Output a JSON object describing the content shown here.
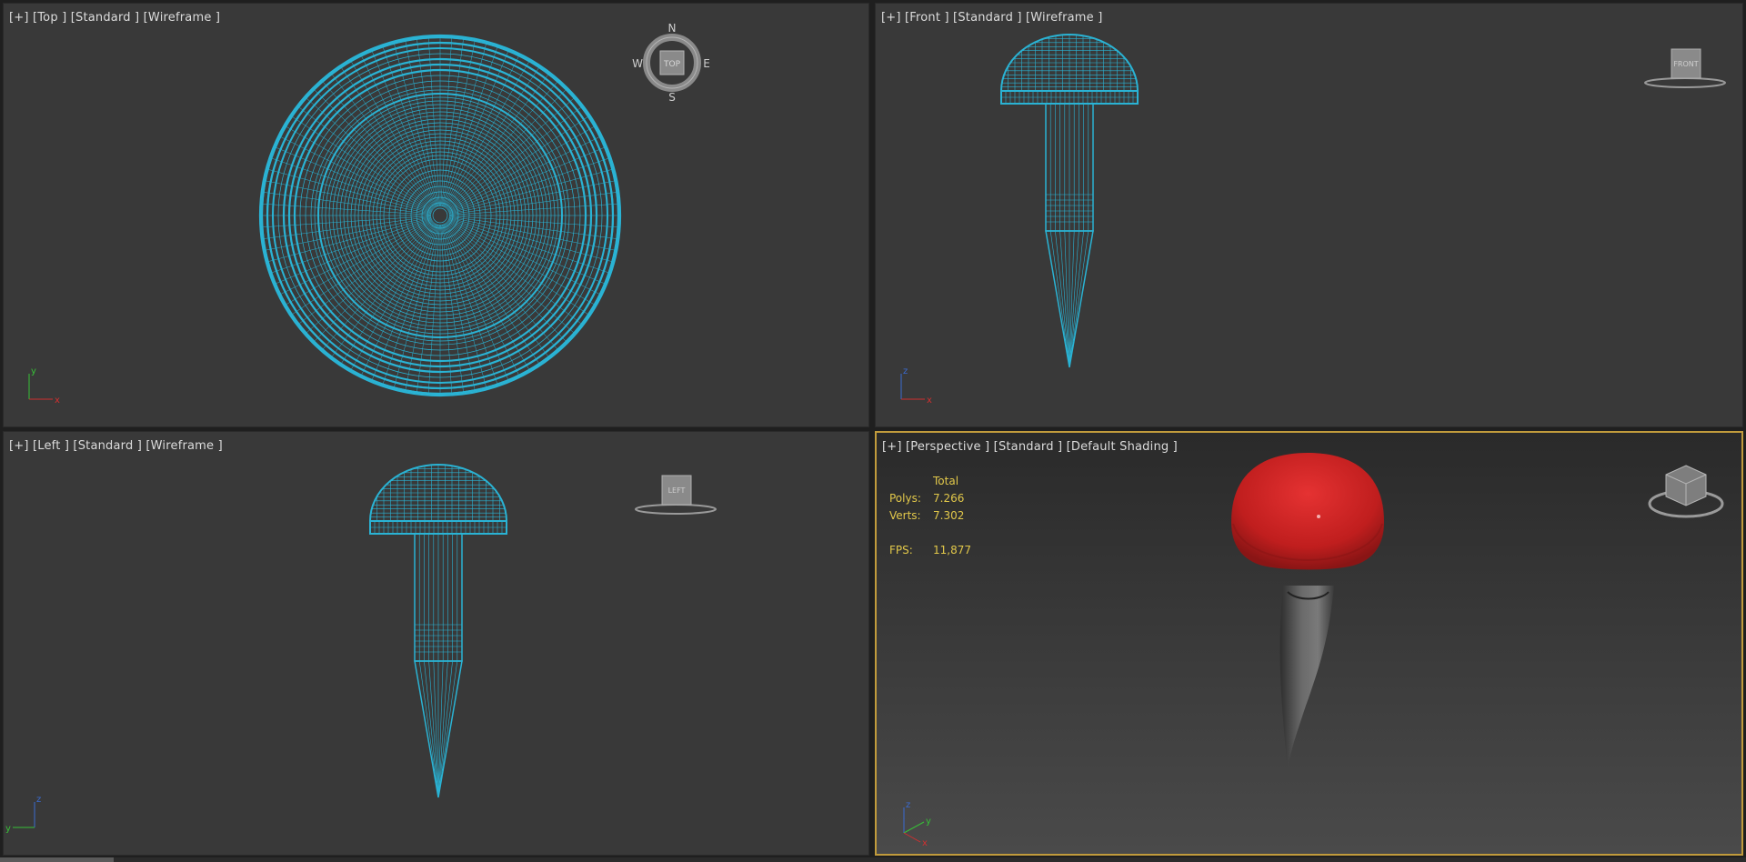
{
  "viewports": {
    "top": {
      "label": "[+] [Top ] [Standard ] [Wireframe ]"
    },
    "front": {
      "label": "[+] [Front ] [Standard ] [Wireframe ]"
    },
    "left": {
      "label": "[+] [Left ] [Standard ] [Wireframe ]"
    },
    "perspective": {
      "label": "[+] [Perspective ] [Standard ] [Default Shading ]"
    }
  },
  "stats": {
    "header": "Total",
    "polys_label": "Polys:",
    "polys_value": "7.266",
    "verts_label": "Verts:",
    "verts_value": "7.302",
    "fps_label": "FPS:",
    "fps_value": "11,877"
  },
  "compass": {
    "n": "N",
    "s": "S",
    "e": "E",
    "w": "W"
  },
  "viewcube": {
    "top": "TOP",
    "front": "FRONT",
    "left": "LEFT"
  },
  "axes": {
    "top": {
      "vertical": "y",
      "horizontal": "x"
    },
    "front": {
      "vertical": "z",
      "horizontal": "x"
    },
    "left": {
      "vertical": "z",
      "horizontal": "y"
    },
    "perspective": {
      "vertical": "z",
      "diagonal": "y",
      "horizontal": "x"
    }
  },
  "colors": {
    "wire": "#2ab3d4",
    "head": "#d42626",
    "highlight": "#c19b3c",
    "stats_text": "#e2c84a"
  }
}
